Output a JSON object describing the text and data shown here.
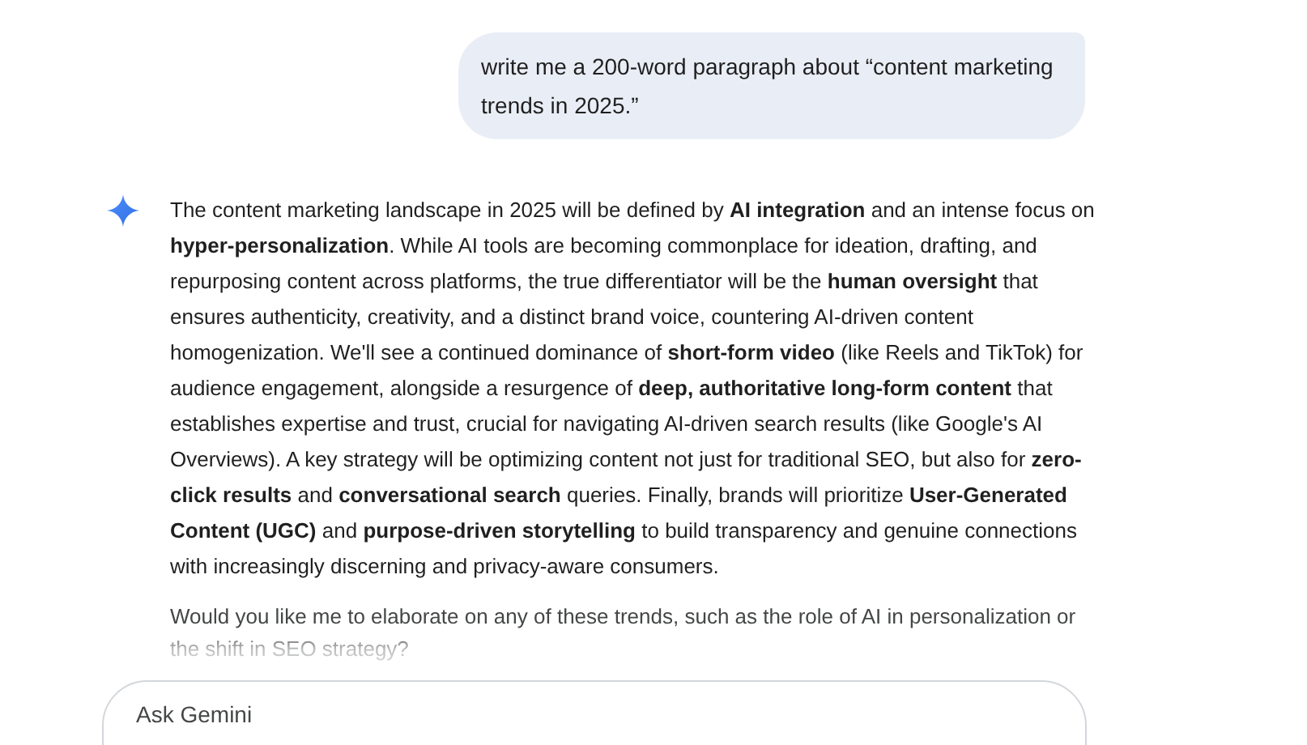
{
  "user_message": {
    "text": "write me a 200-word paragraph about “content marketing trends in 2025.”"
  },
  "response": {
    "paragraphs": [
      "The content marketing landscape in 2025 will be defined by **AI integration** and an intense focus on **hyper-personalization**. While AI tools are becoming commonplace for ideation, drafting, and repurposing content across platforms, the true differentiator will be the **human oversight** that ensures authenticity, creativity, and a distinct brand voice, countering AI-driven content homogenization. We'll see a continued dominance of **short-form video** (like Reels and TikTok) for audience engagement, alongside a resurgence of **deep, authoritative long-form content** that establishes expertise and trust, crucial for navigating AI-driven search results (like Google's AI Overviews). A key strategy will be optimizing content not just for traditional SEO, but also for **zero-click results** and **conversational search** queries. Finally, brands will prioritize **User-Generated Content (UGC)** and **purpose-driven storytelling** to build transparency and genuine connections with increasingly discerning and privacy-aware consumers.",
      "Would you like me to elaborate on any of these trends, such as the role of AI in personalization or the shift in SEO strategy?"
    ]
  },
  "input": {
    "placeholder": "Ask Gemini"
  }
}
